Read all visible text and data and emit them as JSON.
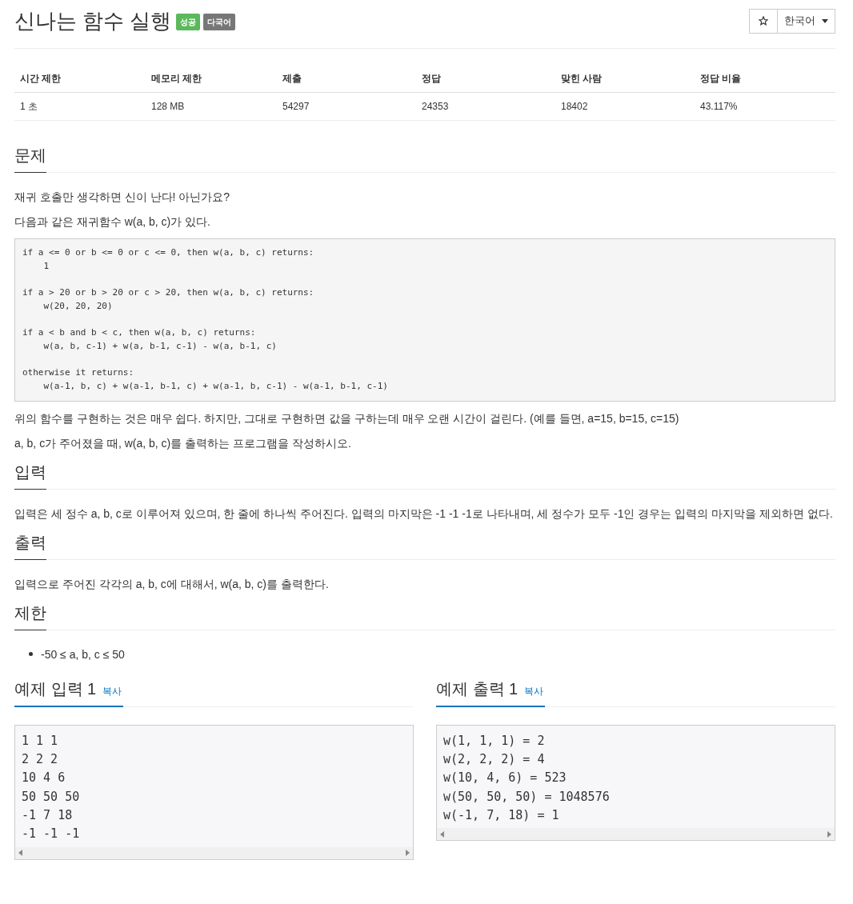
{
  "title": "신나는 함수 실행",
  "labels": [
    {
      "text": "성공",
      "color": "#5cb85c"
    },
    {
      "text": "다국어",
      "color": "#777777"
    }
  ],
  "language_dropdown": "한국어",
  "info_table": {
    "columns": [
      "시간 제한",
      "메모리 제한",
      "제출",
      "정답",
      "맞힌 사람",
      "정답 비율"
    ],
    "rows": [
      [
        "1 초",
        "128 MB",
        "54297",
        "24353",
        "18402",
        "43.117%"
      ]
    ]
  },
  "sections": [
    {
      "heading": "문제",
      "blocks": [
        {
          "kind": "paragraph",
          "text": "재귀 호출만 생각하면 신이 난다! 아닌가요?"
        },
        {
          "kind": "paragraph",
          "text": "다음과 같은 재귀함수 w(a, b, c)가 있다."
        },
        {
          "kind": "code",
          "stanzas": [
            [
              "if a <= 0 or b <= 0 or c <= 0, then w(a, b, c) returns:",
              "    1"
            ],
            [
              "if a > 20 or b > 20 or c > 20, then w(a, b, c) returns:",
              "    w(20, 20, 20)"
            ],
            [
              "if a < b and b < c, then w(a, b, c) returns:",
              "    w(a, b, c-1) + w(a, b-1, c-1) - w(a, b-1, c)"
            ],
            [
              "otherwise it returns:",
              "    w(a-1, b, c) + w(a-1, b-1, c) + w(a-1, b, c-1) - w(a-1, b-1, c-1)"
            ]
          ]
        },
        {
          "kind": "paragraph",
          "text": "위의 함수를 구현하는 것은 매우 쉽다. 하지만, 그대로 구현하면 값을 구하는데 매우 오랜 시간이 걸린다. (예를 들면, a=15, b=15, c=15)"
        },
        {
          "kind": "paragraph",
          "text": "a, b, c가 주어졌을 때, w(a, b, c)를 출력하는 프로그램을 작성하시오."
        }
      ]
    },
    {
      "heading": "입력",
      "blocks": [
        {
          "kind": "paragraph",
          "text": "입력은 세 정수 a, b, c로 이루어져 있으며, 한 줄에 하나씩 주어진다. 입력의 마지막은 -1 -1 -1로 나타내며, 세 정수가 모두 -1인 경우는 입력의 마지막을 제외하면 없다."
        }
      ]
    },
    {
      "heading": "출력",
      "blocks": [
        {
          "kind": "paragraph",
          "text": "입력으로 주어진 각각의 a, b, c에 대해서, w(a, b, c)를 출력한다."
        }
      ]
    },
    {
      "heading": "제한",
      "blocks": [
        {
          "kind": "list",
          "items": [
            "-50 ≤ a, b, c ≤ 50"
          ]
        }
      ]
    }
  ],
  "samples": [
    {
      "title": "예제 입력 1",
      "copy_label": "복사",
      "lines": [
        "1 1 1",
        "2 2 2",
        "10 4 6",
        "50 50 50",
        "-1 7 18",
        "-1 -1 -1"
      ]
    },
    {
      "title": "예제 출력 1",
      "copy_label": "복사",
      "lines": [
        "w(1, 1, 1) = 2",
        "w(2, 2, 2) = 4",
        "w(10, 4, 6) = 523",
        "w(50, 50, 50) = 1048576",
        "w(-1, 7, 18) = 1"
      ]
    }
  ]
}
